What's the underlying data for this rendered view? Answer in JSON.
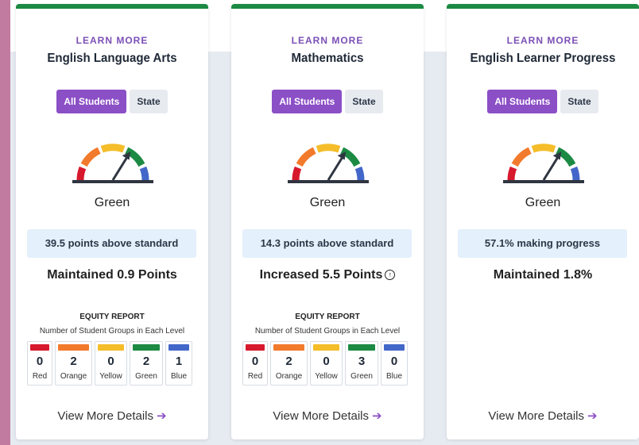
{
  "colors": {
    "red": "#d7192e",
    "orange": "#f27a2c",
    "yellow": "#f4bd29",
    "green": "#1c8a43",
    "blue": "#4367c9",
    "accent_purple": "#8b4fc6"
  },
  "cards": [
    {
      "learn_more": "LEARN MORE",
      "title": "English Language Arts",
      "toggle": {
        "all_students": "All Students",
        "state": "State"
      },
      "gauge_level": "green",
      "level": "Green",
      "status": "39.5 points above standard",
      "change": "Maintained 0.9 Points",
      "equity": {
        "title": "EQUITY REPORT",
        "subtitle": "Number of Student Groups in Each Level",
        "items": [
          {
            "count": "0",
            "label": "Red"
          },
          {
            "count": "2",
            "label": "Orange"
          },
          {
            "count": "0",
            "label": "Yellow"
          },
          {
            "count": "2",
            "label": "Green"
          },
          {
            "count": "1",
            "label": "Blue"
          }
        ]
      },
      "details": "View More Details"
    },
    {
      "learn_more": "LEARN MORE",
      "title": "Mathematics",
      "toggle": {
        "all_students": "All Students",
        "state": "State"
      },
      "gauge_level": "green",
      "level": "Green",
      "status": "14.3 points above standard",
      "change": "Increased 5.5 Points",
      "change_icon": "arrow-up-circle-icon",
      "equity": {
        "title": "EQUITY REPORT",
        "subtitle": "Number of Student Groups in Each Level",
        "items": [
          {
            "count": "0",
            "label": "Red"
          },
          {
            "count": "2",
            "label": "Orange"
          },
          {
            "count": "0",
            "label": "Yellow"
          },
          {
            "count": "3",
            "label": "Green"
          },
          {
            "count": "0",
            "label": "Blue"
          }
        ]
      },
      "details": "View More Details"
    },
    {
      "learn_more": "LEARN MORE",
      "title": "English Learner Progress",
      "toggle": {
        "all_students": "All Students",
        "state": "State"
      },
      "gauge_level": "green",
      "level": "Green",
      "status": "57.1% making progress",
      "change": "Maintained 1.8%",
      "details": "View More Details"
    }
  ]
}
